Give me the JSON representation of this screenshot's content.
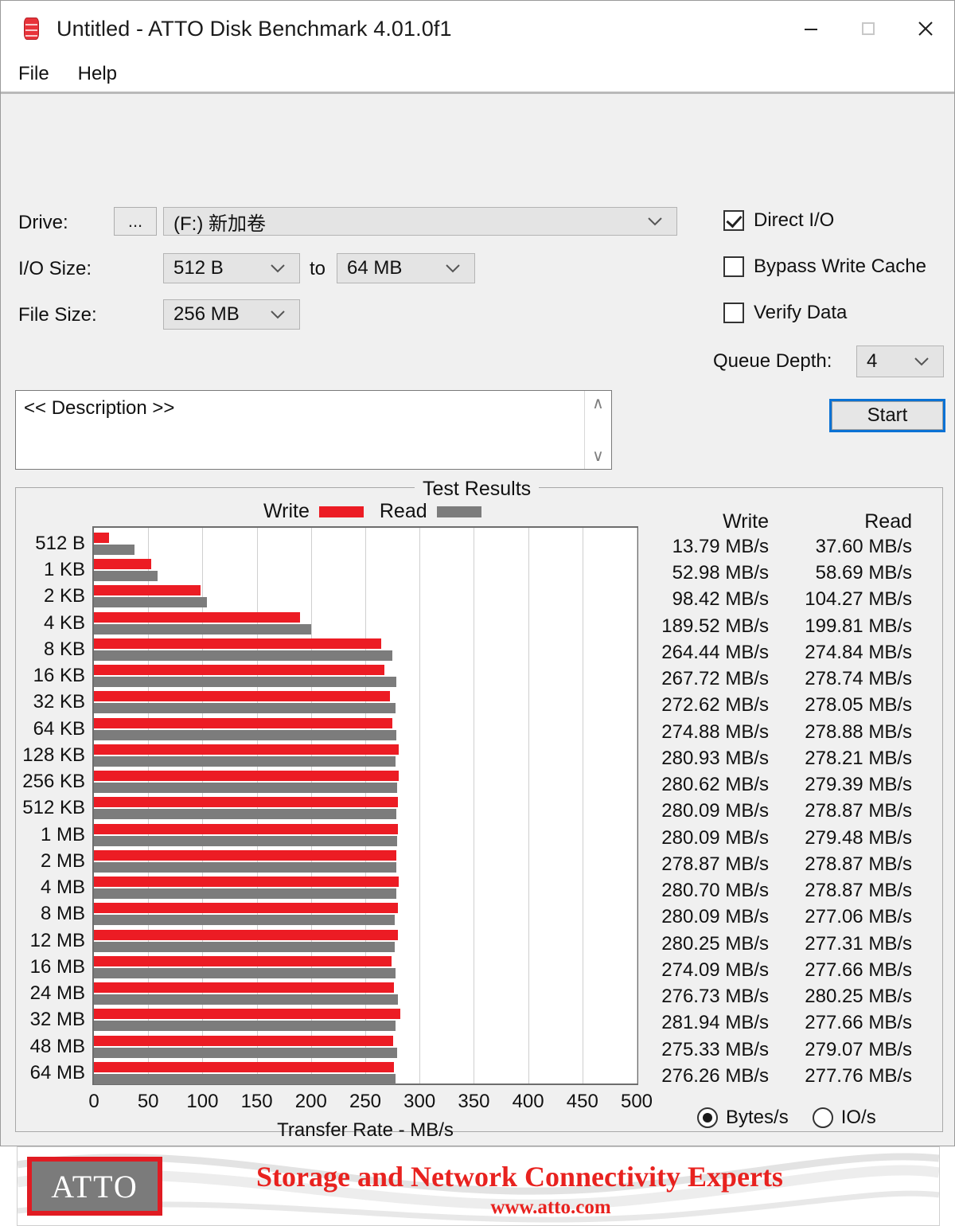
{
  "window": {
    "title": "Untitled - ATTO Disk Benchmark 4.01.0f1",
    "icon": "disk-stack-icon",
    "minimize_label": "Minimize",
    "maximize_label": "Maximize",
    "close_label": "Close"
  },
  "menu": {
    "items": [
      {
        "label": "File"
      },
      {
        "label": "Help"
      }
    ]
  },
  "settings": {
    "drive_label": "Drive:",
    "browse_button": "...",
    "drive_value": "(F:) 新加卷",
    "io_size_label": "I/O Size:",
    "io_size_from": "512 B",
    "io_size_to_label": "to",
    "io_size_to": "64 MB",
    "file_size_label": "File Size:",
    "file_size_value": "256 MB",
    "checkboxes": [
      {
        "label": "Direct I/O",
        "checked": true
      },
      {
        "label": "Bypass Write Cache",
        "checked": false
      },
      {
        "label": "Verify Data",
        "checked": false
      }
    ],
    "queue_depth_label": "Queue Depth:",
    "queue_depth_value": "4"
  },
  "description": {
    "text": "<< Description >>",
    "scroll_up": "∧",
    "scroll_down": "∨"
  },
  "start_button": "Start",
  "results": {
    "group_title": "Test Results",
    "legend": [
      {
        "label": "Write",
        "color": "#ec1c24"
      },
      {
        "label": "Read",
        "color": "#7c7c7c"
      }
    ],
    "column_headers": {
      "write": "Write",
      "read": "Read"
    },
    "units": {
      "options": [
        {
          "label": "Bytes/s",
          "selected": true
        },
        {
          "label": "IO/s",
          "selected": false
        }
      ]
    }
  },
  "chart_data": {
    "type": "bar",
    "title": "Test Results",
    "xlabel": "Transfer Rate - MB/s",
    "ylabel": "",
    "xlim": [
      0,
      500
    ],
    "xticks": [
      0,
      50,
      100,
      150,
      200,
      250,
      300,
      350,
      400,
      450,
      500
    ],
    "grid": true,
    "legend_position": "top",
    "orientation": "horizontal",
    "categories": [
      "512 B",
      "1 KB",
      "2 KB",
      "4 KB",
      "8 KB",
      "16 KB",
      "32 KB",
      "64 KB",
      "128 KB",
      "256 KB",
      "512 KB",
      "1 MB",
      "2 MB",
      "4 MB",
      "8 MB",
      "12 MB",
      "16 MB",
      "24 MB",
      "32 MB",
      "48 MB",
      "64 MB"
    ],
    "series": [
      {
        "name": "Write",
        "color": "#ec1c24",
        "values": [
          13.79,
          52.98,
          98.42,
          189.52,
          264.44,
          267.72,
          272.62,
          274.88,
          280.93,
          280.62,
          280.09,
          280.09,
          278.87,
          280.7,
          280.09,
          280.25,
          274.09,
          276.73,
          281.94,
          275.33,
          276.26
        ],
        "labels": [
          "13.79 MB/s",
          "52.98 MB/s",
          "98.42 MB/s",
          "189.52 MB/s",
          "264.44 MB/s",
          "267.72 MB/s",
          "272.62 MB/s",
          "274.88 MB/s",
          "280.93 MB/s",
          "280.62 MB/s",
          "280.09 MB/s",
          "280.09 MB/s",
          "278.87 MB/s",
          "280.70 MB/s",
          "280.09 MB/s",
          "280.25 MB/s",
          "274.09 MB/s",
          "276.73 MB/s",
          "281.94 MB/s",
          "275.33 MB/s",
          "276.26 MB/s"
        ]
      },
      {
        "name": "Read",
        "color": "#7c7c7c",
        "values": [
          37.6,
          58.69,
          104.27,
          199.81,
          274.84,
          278.74,
          278.05,
          278.88,
          278.21,
          279.39,
          278.87,
          279.48,
          278.87,
          278.87,
          277.06,
          277.31,
          277.66,
          280.25,
          277.66,
          279.07,
          277.76
        ],
        "labels": [
          "37.60 MB/s",
          "58.69 MB/s",
          "104.27 MB/s",
          "199.81 MB/s",
          "274.84 MB/s",
          "278.74 MB/s",
          "278.05 MB/s",
          "278.88 MB/s",
          "278.21 MB/s",
          "279.39 MB/s",
          "278.87 MB/s",
          "279.48 MB/s",
          "278.87 MB/s",
          "278.87 MB/s",
          "277.06 MB/s",
          "277.31 MB/s",
          "277.66 MB/s",
          "280.25 MB/s",
          "277.66 MB/s",
          "279.07 MB/s",
          "277.76 MB/s"
        ]
      }
    ]
  },
  "banner": {
    "logo_text": "ATTO",
    "tagline": "Storage and Network Connectivity Experts",
    "url": "www.atto.com"
  }
}
